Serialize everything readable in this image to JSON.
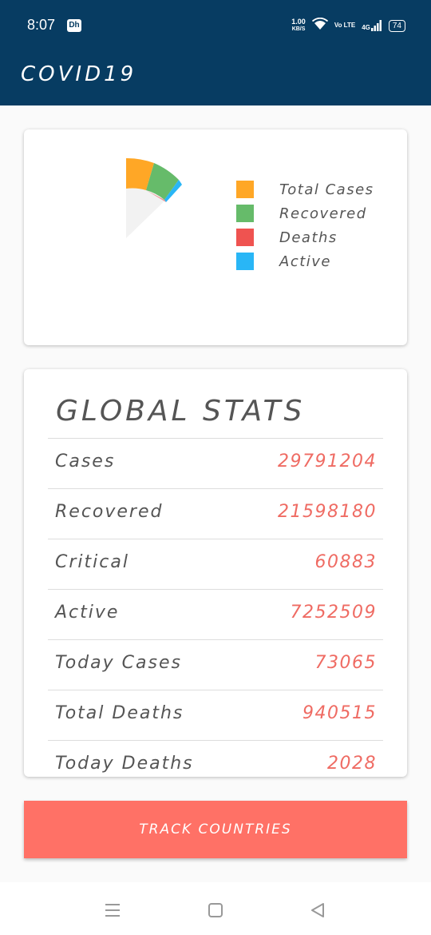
{
  "status_bar": {
    "time": "8:07",
    "app_badge": "Dh",
    "net_speed": "1.00",
    "net_unit": "KB/S",
    "volte": "Vo LTE",
    "signal": "4G",
    "battery": "74"
  },
  "app_bar": {
    "title": "COVID19"
  },
  "chart": {
    "legend": [
      {
        "label": "Total Cases",
        "color": "#ffa726"
      },
      {
        "label": "Recovered",
        "color": "#66bb6a"
      },
      {
        "label": "Deaths",
        "color": "#ef5350"
      },
      {
        "label": "Active",
        "color": "#29b6f6"
      }
    ]
  },
  "global_stats": {
    "title": "GLOBAL STATS",
    "rows": [
      {
        "label": "Cases",
        "value": "29791204"
      },
      {
        "label": "Recovered",
        "value": "21598180"
      },
      {
        "label": "Critical",
        "value": "60883"
      },
      {
        "label": "Active",
        "value": "7252509"
      },
      {
        "label": "Today Cases",
        "value": "73065"
      },
      {
        "label": "Total Deaths",
        "value": "940515"
      },
      {
        "label": "Today Deaths",
        "value": "2028"
      }
    ]
  },
  "track_button": {
    "label": "TRACK COUNTRIES"
  },
  "nav_bar": {
    "icons": [
      "menu-icon",
      "home-square-icon",
      "back-triangle-icon"
    ]
  }
}
